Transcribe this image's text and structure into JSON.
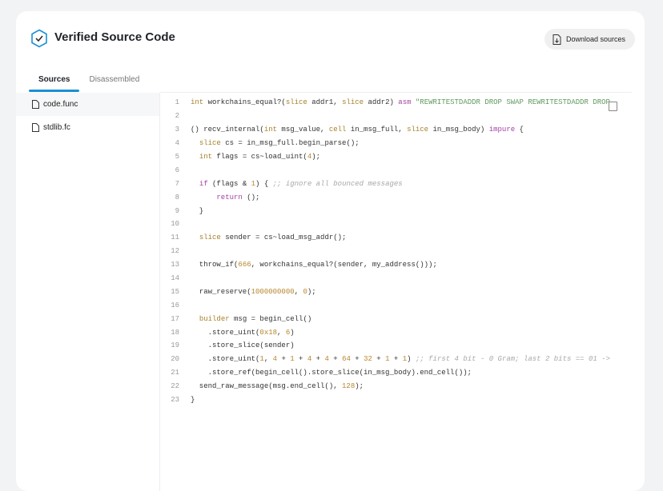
{
  "header": {
    "title": "Verified Source Code",
    "download_label": "Download sources"
  },
  "tabs": [
    {
      "label": "Sources",
      "active": true
    },
    {
      "label": "Disassembled",
      "active": false
    }
  ],
  "files": [
    {
      "name": "code.func",
      "active": true
    },
    {
      "name": "stdlib.fc",
      "active": false
    }
  ],
  "colors": {
    "accent": "#1a8fd6"
  },
  "code": [
    [
      [
        "kw",
        "int"
      ],
      [
        "t",
        " workchains_equal?("
      ],
      [
        "kw",
        "slice"
      ],
      [
        "t",
        " addr1, "
      ],
      [
        "kw",
        "slice"
      ],
      [
        "t",
        " addr2) "
      ],
      [
        "pk",
        "asm"
      ],
      [
        "t",
        " "
      ],
      [
        "str",
        "\"REWRITESTDADDR DROP SWAP REWRITESTDADDR DROP"
      ]
    ],
    [],
    [
      [
        "t",
        "() recv_internal("
      ],
      [
        "kw",
        "int"
      ],
      [
        "t",
        " msg_value, "
      ],
      [
        "kw",
        "cell"
      ],
      [
        "t",
        " in_msg_full, "
      ],
      [
        "kw",
        "slice"
      ],
      [
        "t",
        " in_msg_body) "
      ],
      [
        "pk",
        "impure"
      ],
      [
        "t",
        " {"
      ]
    ],
    [
      [
        "t",
        "  "
      ],
      [
        "kw",
        "slice"
      ],
      [
        "t",
        " cs = in_msg_full.begin_parse();"
      ]
    ],
    [
      [
        "t",
        "  "
      ],
      [
        "kw",
        "int"
      ],
      [
        "t",
        " flags = cs~load_uint("
      ],
      [
        "n",
        "4"
      ],
      [
        "t",
        ");"
      ]
    ],
    [],
    [
      [
        "t",
        "  "
      ],
      [
        "pk",
        "if"
      ],
      [
        "t",
        " (flags & "
      ],
      [
        "n",
        "1"
      ],
      [
        "t",
        ") { "
      ],
      [
        "cm",
        ";; ignore all bounced messages"
      ]
    ],
    [
      [
        "t",
        "      "
      ],
      [
        "pk",
        "return"
      ],
      [
        "t",
        " ();"
      ]
    ],
    [
      [
        "t",
        "  }"
      ]
    ],
    [],
    [
      [
        "t",
        "  "
      ],
      [
        "kw",
        "slice"
      ],
      [
        "t",
        " sender = cs~load_msg_addr();"
      ]
    ],
    [],
    [
      [
        "t",
        "  throw_if("
      ],
      [
        "n",
        "666"
      ],
      [
        "t",
        ", workchains_equal?(sender, my_address()));"
      ]
    ],
    [],
    [
      [
        "t",
        "  raw_reserve("
      ],
      [
        "n",
        "1000000000"
      ],
      [
        "t",
        ", "
      ],
      [
        "n",
        "0"
      ],
      [
        "t",
        ");"
      ]
    ],
    [],
    [
      [
        "t",
        "  "
      ],
      [
        "kw",
        "builder"
      ],
      [
        "t",
        " msg = begin_cell()"
      ]
    ],
    [
      [
        "t",
        "    .store_uint("
      ],
      [
        "n",
        "0x18"
      ],
      [
        "t",
        ", "
      ],
      [
        "n",
        "6"
      ],
      [
        "t",
        ")"
      ]
    ],
    [
      [
        "t",
        "    .store_slice(sender)"
      ]
    ],
    [
      [
        "t",
        "    .store_uint("
      ],
      [
        "n",
        "1"
      ],
      [
        "t",
        ", "
      ],
      [
        "n",
        "4"
      ],
      [
        "t",
        " + "
      ],
      [
        "n",
        "1"
      ],
      [
        "t",
        " + "
      ],
      [
        "n",
        "4"
      ],
      [
        "t",
        " + "
      ],
      [
        "n",
        "4"
      ],
      [
        "t",
        " + "
      ],
      [
        "n",
        "64"
      ],
      [
        "t",
        " + "
      ],
      [
        "n",
        "32"
      ],
      [
        "t",
        " + "
      ],
      [
        "n",
        "1"
      ],
      [
        "t",
        " + "
      ],
      [
        "n",
        "1"
      ],
      [
        "t",
        ") "
      ],
      [
        "cm",
        ";; first 4 bit - 0 Gram; last 2 bits == 01 ->"
      ]
    ],
    [
      [
        "t",
        "    .store_ref(begin_cell().store_slice(in_msg_body).end_cell());"
      ]
    ],
    [
      [
        "t",
        "  send_raw_message(msg.end_cell(), "
      ],
      [
        "n",
        "128"
      ],
      [
        "t",
        ");"
      ]
    ],
    [
      [
        "t",
        "}"
      ]
    ]
  ]
}
